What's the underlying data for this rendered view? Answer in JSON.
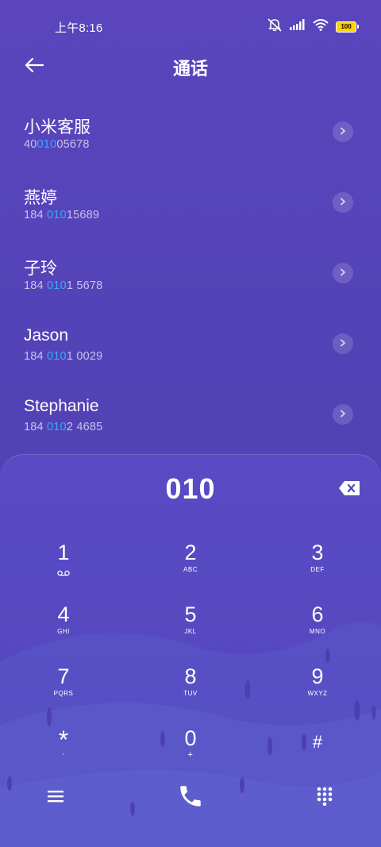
{
  "status_bar": {
    "time": "上午8:16",
    "battery": "100"
  },
  "header": {
    "title": "通话"
  },
  "contacts": [
    {
      "name": "小米客服",
      "num_pre": "40",
      "num_hl": "010",
      "num_post": "05678"
    },
    {
      "name": "燕婷",
      "num_pre": "184 ",
      "num_hl": "010",
      "num_post": "15689"
    },
    {
      "name": "子玲",
      "num_pre": "184 ",
      "num_hl": "010",
      "num_post": "1 5678"
    },
    {
      "name": "Jason",
      "num_pre": "184 ",
      "num_hl": "010",
      "num_post": "1 0029"
    },
    {
      "name": "Stephanie",
      "num_pre": "184 ",
      "num_hl": "010",
      "num_post": "2 4685"
    }
  ],
  "dialer": {
    "input": "010",
    "keys": [
      {
        "digit": "1",
        "letters": ""
      },
      {
        "digit": "2",
        "letters": "ABC"
      },
      {
        "digit": "3",
        "letters": "DEF"
      },
      {
        "digit": "4",
        "letters": "GHI"
      },
      {
        "digit": "5",
        "letters": "JKL"
      },
      {
        "digit": "6",
        "letters": "MNO"
      },
      {
        "digit": "7",
        "letters": "PQRS"
      },
      {
        "digit": "8",
        "letters": "TUV"
      },
      {
        "digit": "9",
        "letters": "WXYZ"
      },
      {
        "digit": "*",
        "letters": ","
      },
      {
        "digit": "0",
        "letters": "+"
      },
      {
        "digit": "#",
        "letters": ""
      }
    ]
  },
  "icons": {
    "back": "arrow-left-icon",
    "mute": "bell-off-icon",
    "signal": "signal-icon",
    "wifi": "wifi-icon",
    "delete": "backspace-icon",
    "voicemail": "voicemail-icon",
    "menu": "menu-icon",
    "call": "phone-icon",
    "keypad": "keypad-icon"
  },
  "colors": {
    "highlight": "#3aa8ff",
    "battery": "#ffd200",
    "background": "#5a45bd"
  }
}
